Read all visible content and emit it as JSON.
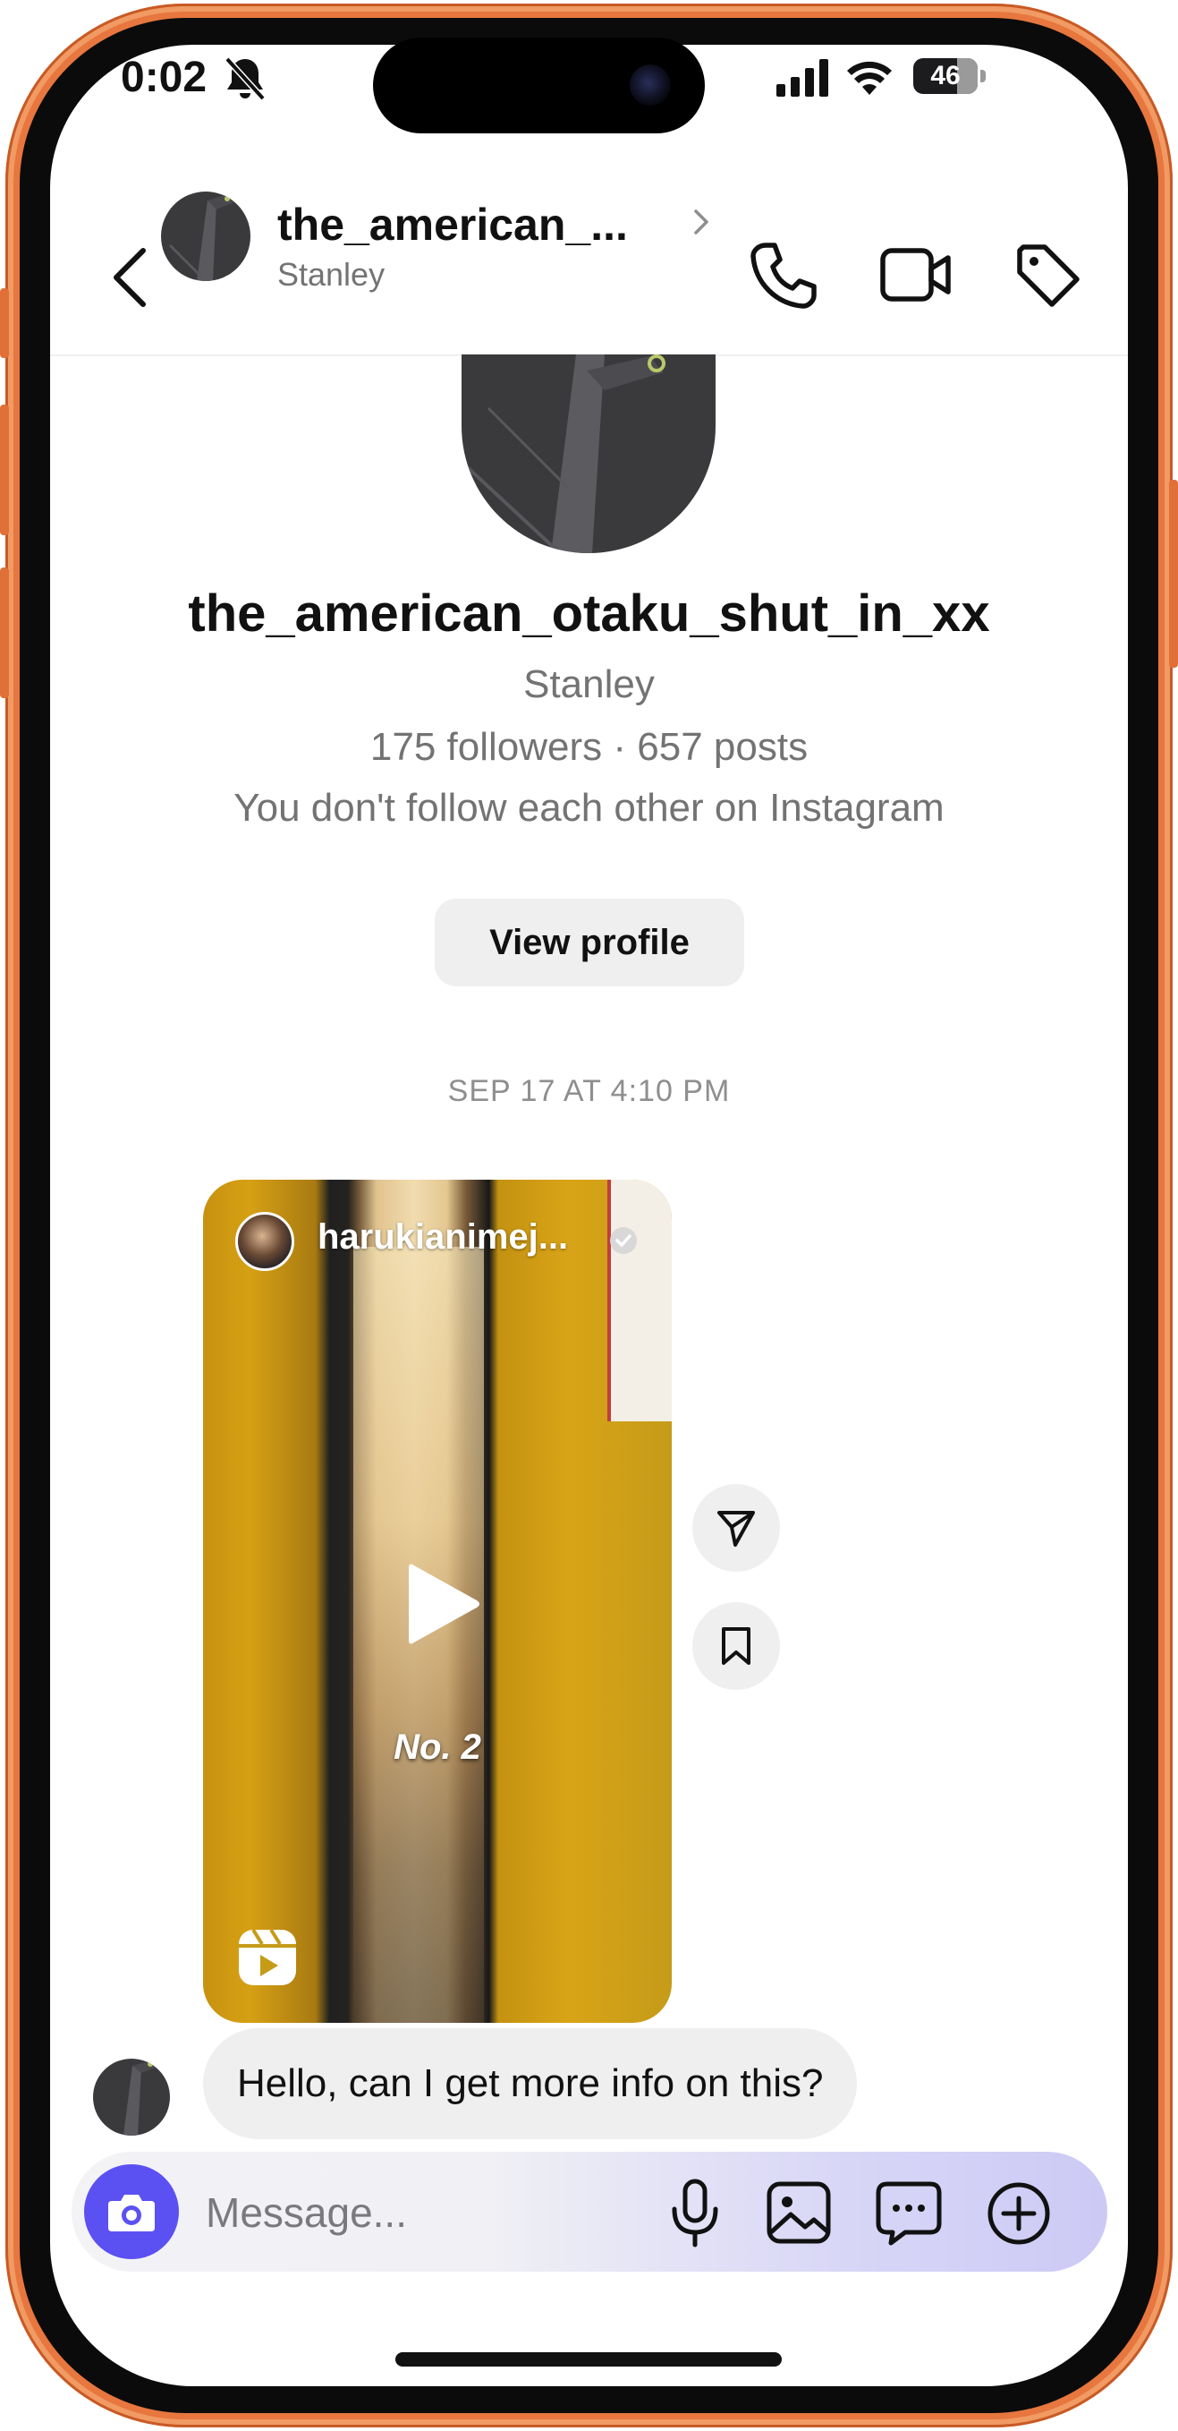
{
  "status_bar": {
    "time": "0:02",
    "battery": "46",
    "icons": [
      "bell-slash-icon",
      "cellular-signal-icon",
      "wifi-icon",
      "battery-icon"
    ]
  },
  "header": {
    "username": "the_american_...",
    "display_name": "Stanley",
    "icons": [
      "back-chevron-icon",
      "chevron-right-icon",
      "phone-icon",
      "video-camera-icon",
      "tag-icon"
    ]
  },
  "profile": {
    "username": "the_american_otaku_shut_in_xx",
    "full_name": "Stanley",
    "stats": "175 followers · 657 posts",
    "relationship": "You don't follow each other on Instagram",
    "view_profile_label": "View profile"
  },
  "conversation": {
    "timestamp": "SEP 17 AT 4:10 PM",
    "shared_reel": {
      "author": "harukianimej...",
      "caption": "No. 2",
      "icons": [
        "verified-badge-icon",
        "play-icon",
        "reels-icon"
      ]
    },
    "actions": {
      "icons": [
        "share-icon",
        "bookmark-icon"
      ]
    },
    "messages": [
      {
        "text": "Hello, can I get more info on this?"
      }
    ]
  },
  "composer": {
    "placeholder": "Message...",
    "value": "",
    "accent_color": "#5b51f2",
    "icons": [
      "camera-icon",
      "microphone-icon",
      "gallery-icon",
      "sticker-icon",
      "plus-icon"
    ]
  },
  "colors": {
    "frame": "#e7773f",
    "text_primary": "#111111",
    "text_secondary": "#737373",
    "bubble": "#efeff0"
  }
}
